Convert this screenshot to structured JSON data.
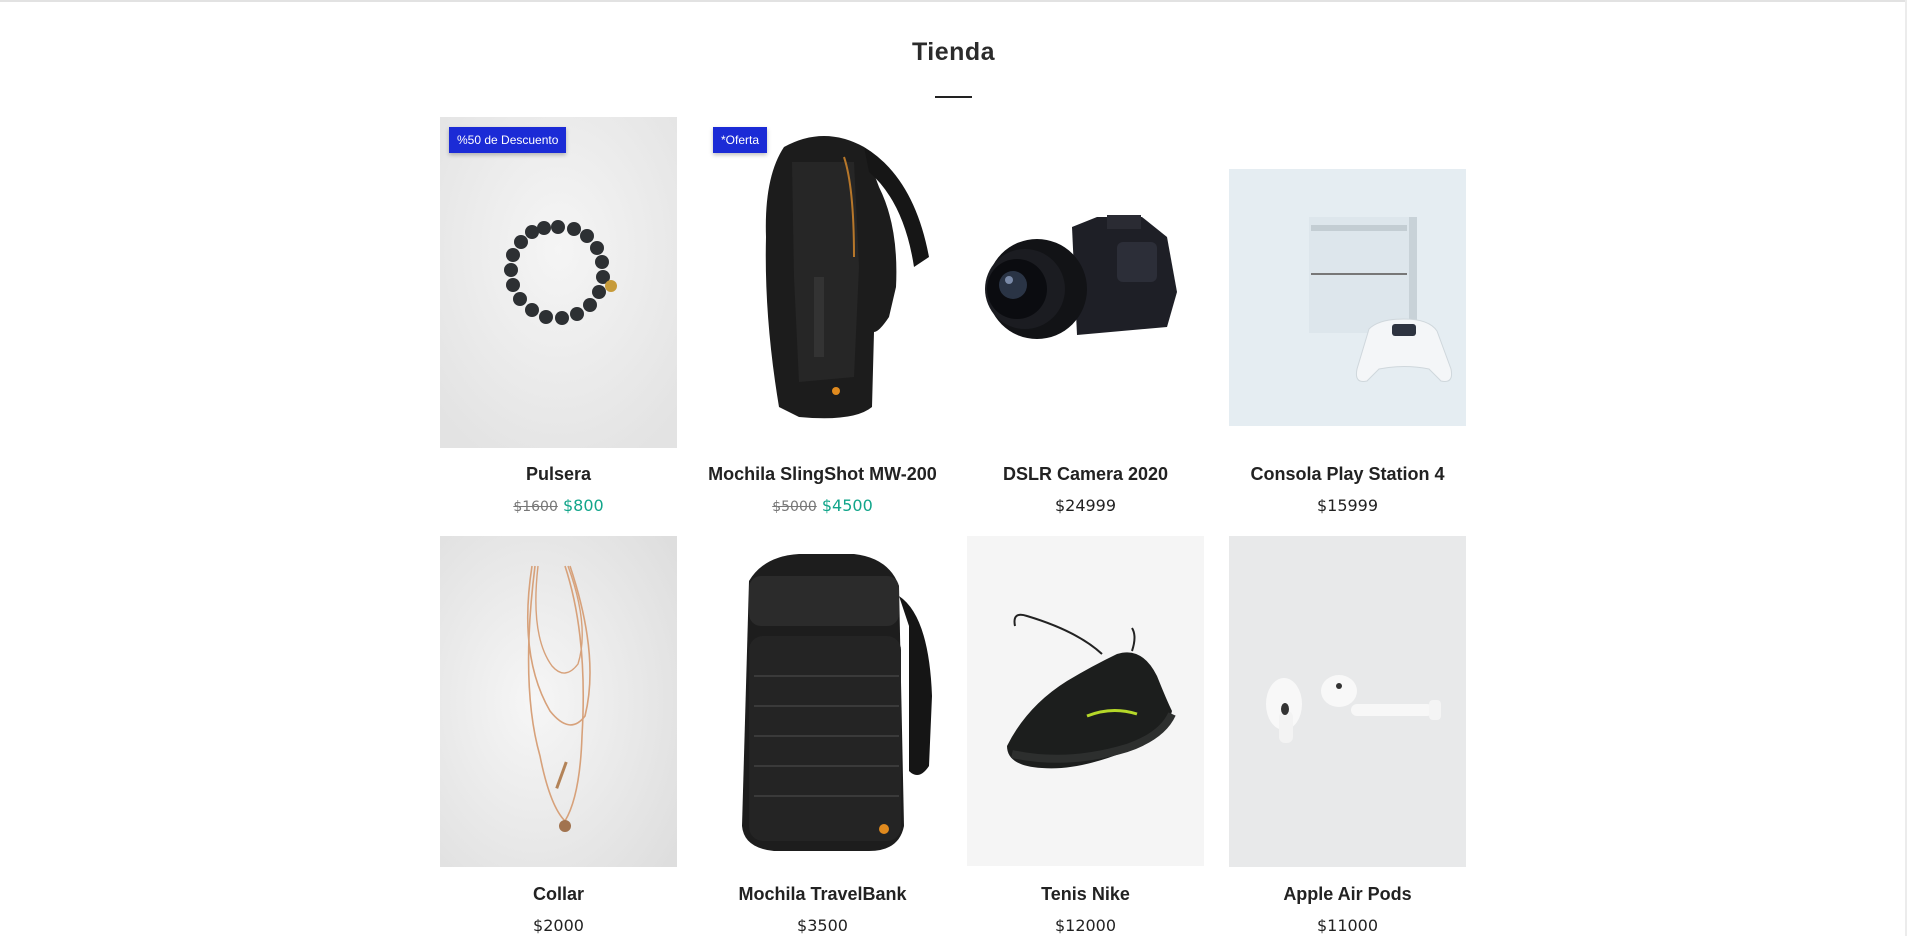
{
  "page": {
    "title": "Tienda"
  },
  "products": [
    {
      "name": "Pulsera",
      "badge": "%50 de Descuento",
      "old_price": "$1600",
      "price": "$800",
      "image_icon": "bracelet-image"
    },
    {
      "name": "Mochila SlingShot MW-200",
      "badge": "*Oferta",
      "old_price": "$5000",
      "price": "$4500",
      "image_icon": "sling-backpack-image"
    },
    {
      "name": "DSLR Camera 2020",
      "price": "$24999",
      "image_icon": "camera-image"
    },
    {
      "name": "Consola Play Station 4",
      "price": "$15999",
      "image_icon": "console-image"
    },
    {
      "name": "Collar",
      "price": "$2000",
      "image_icon": "necklace-image"
    },
    {
      "name": "Mochila TravelBank",
      "price": "$3500",
      "image_icon": "backpack-image"
    },
    {
      "name": "Tenis Nike",
      "price": "$12000",
      "image_icon": "sneaker-image"
    },
    {
      "name": "Apple Air Pods",
      "price": "$11000",
      "image_icon": "airpods-image"
    }
  ],
  "colors": {
    "badge": "#1b2bd6",
    "sale_price": "#11a58a"
  }
}
